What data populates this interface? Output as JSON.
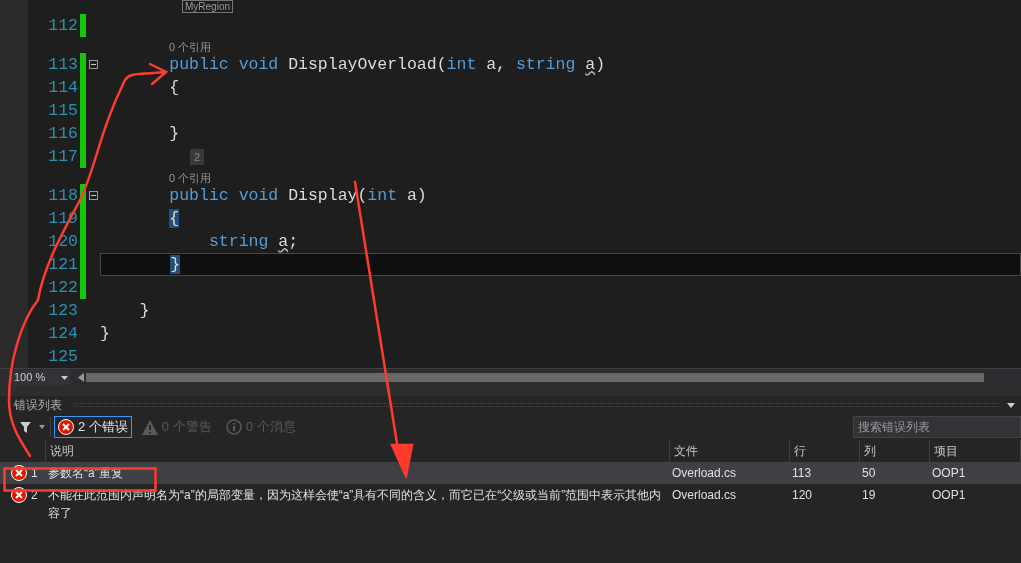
{
  "editor": {
    "region_label": "MyRegion",
    "lines": [
      {
        "number": "112",
        "changed": true
      },
      {
        "codelens": "0 个引用"
      },
      {
        "number": "113",
        "changed": true,
        "fold": true,
        "tokens": [
          {
            "kind": "keyword",
            "text": "       public "
          },
          {
            "kind": "keyword",
            "text": "void "
          },
          {
            "kind": "text",
            "text": "DisplayOverload("
          },
          {
            "kind": "keyword",
            "text": "int "
          },
          {
            "kind": "text",
            "text": "a, "
          },
          {
            "kind": "keyword",
            "text": "string "
          },
          {
            "kind": "error",
            "text": "a"
          },
          {
            "kind": "text",
            "text": ")"
          }
        ]
      },
      {
        "number": "114",
        "changed": true,
        "tokens": [
          {
            "kind": "text",
            "text": "       {"
          }
        ]
      },
      {
        "number": "115",
        "changed": true
      },
      {
        "number": "116",
        "changed": true,
        "tokens": [
          {
            "kind": "text",
            "text": "       }"
          }
        ]
      },
      {
        "number": "117",
        "changed": true,
        "hint": "2"
      },
      {
        "codelens": "0 个引用"
      },
      {
        "number": "118",
        "changed": true,
        "fold": true,
        "tokens": [
          {
            "kind": "keyword",
            "text": "       public "
          },
          {
            "kind": "keyword",
            "text": "void "
          },
          {
            "kind": "text",
            "text": "Display("
          },
          {
            "kind": "keyword",
            "text": "int "
          },
          {
            "kind": "text",
            "text": "a)"
          }
        ]
      },
      {
        "number": "119",
        "changed": true,
        "tokens": [
          {
            "kind": "brace",
            "text": "       {"
          }
        ]
      },
      {
        "number": "120",
        "changed": true,
        "tokens": [
          {
            "kind": "keyword",
            "text": "           string "
          },
          {
            "kind": "error",
            "text": "a"
          },
          {
            "kind": "text",
            "text": ";"
          }
        ]
      },
      {
        "number": "121",
        "changed": true,
        "current": true,
        "tokens": [
          {
            "kind": "brace",
            "text": "       }"
          }
        ]
      },
      {
        "number": "122",
        "changed": true
      },
      {
        "number": "123",
        "changed": false,
        "tokens": [
          {
            "kind": "text",
            "text": "    }"
          }
        ]
      },
      {
        "number": "124",
        "changed": false,
        "tokens": [
          {
            "kind": "text",
            "text": "}"
          }
        ]
      },
      {
        "number": "125",
        "changed": false
      }
    ],
    "zoom": "100 %"
  },
  "error_list": {
    "title": "错误列表",
    "filters": [
      {
        "kind": "error",
        "label": "2 个错误",
        "selected": true
      },
      {
        "kind": "warning",
        "label": "0 个警告",
        "selected": false
      },
      {
        "kind": "message",
        "label": "0 个消息",
        "selected": false
      }
    ],
    "search": {
      "placeholder": "搜索错误列表"
    },
    "columns": [
      "说明",
      "文件",
      "行",
      "列",
      "项目"
    ],
    "rows": [
      {
        "index": "1",
        "description": "参数名“a”重复",
        "file": "Overload.cs",
        "line": "113",
        "column": "50",
        "project": "OOP1",
        "selected": true
      },
      {
        "index": "2",
        "description": "不能在此范围内声明名为“a”的局部变量，因为这样会使“a”具有不同的含义，而它已在“父级或当前”范围中表示其他内容了",
        "file": "Overload.cs",
        "line": "120",
        "column": "19",
        "project": "OOP1",
        "selected": false
      }
    ]
  }
}
